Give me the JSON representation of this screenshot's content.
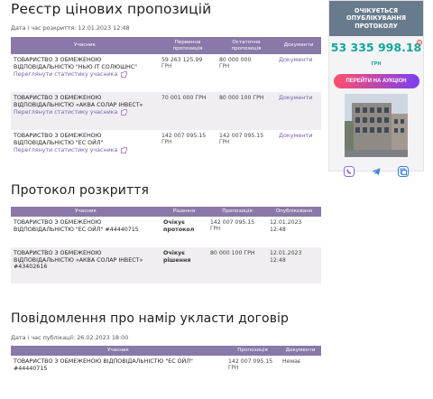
{
  "registry": {
    "title": "Реєстр цінових пропозицій",
    "opened_at": "Дата і час розкриття: 12.01.2023 12:48",
    "columns": [
      "Учасник",
      "Первинна пропозиція",
      "Остаточна пропозиція",
      "Документи"
    ],
    "rows": [
      {
        "participant": "ТОВАРИСТВО З ОБМЕЖЕНОЮ ВІДПОВІДАЛЬНІСТЮ \"НЬЮ ІТ СОЛЮШНС\"",
        "initial": "59 263 125.99",
        "final": "80 000 000",
        "currency": "ГРН",
        "docs": "Документи",
        "stats": "Переглянути статистику учасника"
      },
      {
        "participant": "ТОВАРИСТВО З ОБМЕЖЕНОЮ ВІДПОВІДАЛЬНІСТЮ «АКВА СОЛАР ІНВЕСТ»",
        "initial": "70 001 000 ГРН",
        "final": "80 000 100 ГРН",
        "currency": "",
        "docs": "Документи",
        "stats": "Переглянути статистику учасника"
      },
      {
        "participant": "ТОВАРИСТВО З ОБМЕЖЕНОЮ ВІДПОВІДАЛЬНІСТЮ \"ЕС ОЙЛ\"",
        "initial": "142 007 095.15",
        "final": "142 007 095.15",
        "currency": "ГРН",
        "docs": "Документи",
        "stats": "Переглянути статистику учасника"
      }
    ]
  },
  "protocol": {
    "title": "Протокол розкриття",
    "columns": [
      "Учасник",
      "Рішення",
      "Пропозиція",
      "Опубліковано"
    ],
    "rows": [
      {
        "participant": "ТОВАРИСТВО З ОБМЕЖЕНОЮ ВІДПОВІДАЛЬНІСТЮ \"ЕС ОЙЛ\" #44440715",
        "decision": "Очікує протокол",
        "offer": "142 007 095.15",
        "currency": "ГРН",
        "date": "12.01.2023",
        "time": "12:48"
      },
      {
        "participant": "ТОВАРИСТВО З ОБМЕЖЕНОЮ ВІДПОВІДАЛЬНІСТЮ «АКВА СОЛАР ІНВЕСТ» #43402616",
        "decision": "Очікує рішення",
        "offer": "80 000 100 ГРН",
        "currency": "",
        "date": "12.01.2023",
        "time": "12:48"
      }
    ]
  },
  "notice": {
    "title": "Повідомлення про намір укласти договір",
    "published_at": "Дата і час публікації: 26.02.2023 18:00",
    "columns": [
      "Учасник",
      "Пропозиція",
      "Документи"
    ],
    "rows": [
      {
        "participant": "ТОВАРИСТВО З ОБМЕЖЕНОЮ ВІДПОВІДАЛЬНІСТЮ \"ЕС ОЙЛ\" #44440715",
        "offer": "142 007 095.15",
        "currency": "ГРН",
        "docs": "Немає"
      }
    ]
  },
  "sidebar": {
    "status": "ОЧІКУЄТЬСЯ ОПУБЛІКУВАННЯ ПРОТОКОЛУ",
    "amount": "53 335 998.18",
    "currency": "ГРН",
    "button": "ПЕРЕЙТИ НА АУКЦІОН",
    "icons": [
      "viber-icon",
      "telegram-icon",
      "copy-icon"
    ],
    "colors": {
      "header": "#677b8c",
      "amount": "#13a69b",
      "button_from": "#ff4f6a",
      "button_to": "#7b3ff2"
    }
  },
  "colors": {
    "table_header": "#8a78a8",
    "link": "#7d5ca8",
    "row_alt": "#f0eef3"
  }
}
